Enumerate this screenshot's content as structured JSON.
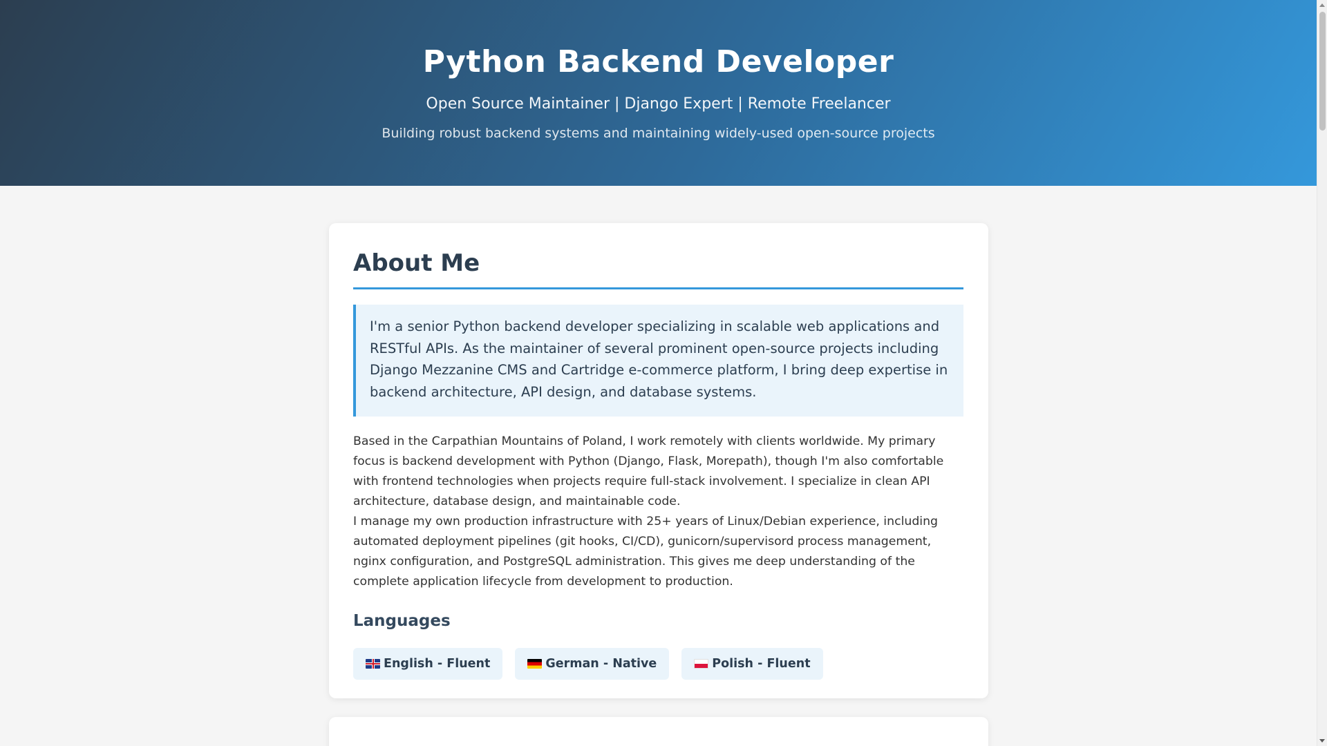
{
  "header": {
    "title": "Python Backend Developer",
    "subtitle": "Open Source Maintainer | Django Expert | Remote Freelancer",
    "tagline": "Building robust backend systems and maintaining widely-used open-source projects"
  },
  "about": {
    "title": "About Me",
    "highlight": "I'm a senior Python backend developer specializing in scalable web applications and RESTful APIs. As the maintainer of several prominent open-source projects including Django Mezzanine CMS and Cartridge e-commerce platform, I bring deep expertise in backend architecture, API design, and database systems.",
    "paragraphs": [
      "Based in the Carpathian Mountains of Poland, I work remotely with clients worldwide. My primary focus is backend development with Python (Django, Flask, Morepath), though I'm also comfortable with frontend technologies when projects require full-stack involvement. I specialize in clean API architecture, database design, and maintainable code.",
      "I manage my own production infrastructure with 25+ years of Linux/Debian experience, including automated deployment pipelines (git hooks, CI/CD), gunicorn/supervisord process management, nginx configuration, and PostgreSQL administration. This gives me deep understanding of the complete application lifecycle from development to production."
    ],
    "languages_title": "Languages",
    "languages": [
      {
        "flag": "uk-flag-icon",
        "label": "English - Fluent"
      },
      {
        "flag": "german-flag-icon",
        "label": "German - Native"
      },
      {
        "flag": "polish-flag-icon",
        "label": "Polish - Fluent"
      }
    ]
  },
  "colors": {
    "header_gradient_start": "#2c3e50",
    "header_gradient_end": "#3498db",
    "accent": "#3498db",
    "highlight_bg": "#eaf4fb",
    "page_bg": "#f5f5f5"
  }
}
